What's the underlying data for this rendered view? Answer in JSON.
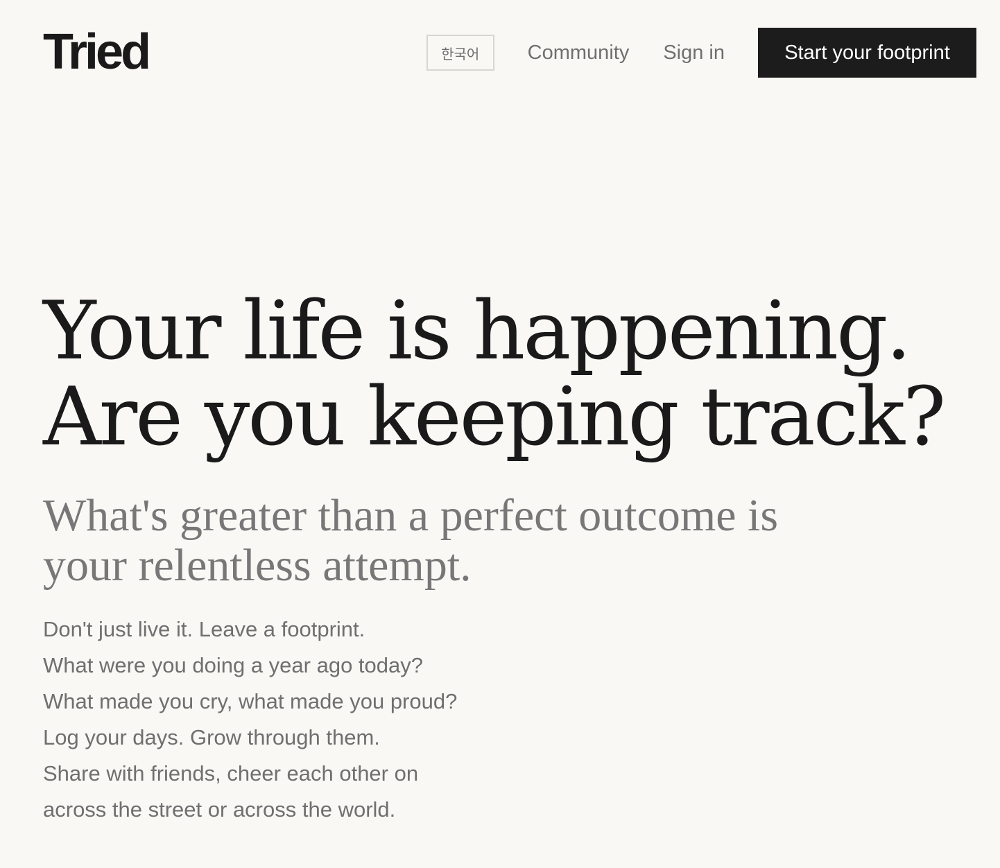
{
  "header": {
    "logo": "Tried",
    "language_button": "한국어",
    "community_link": "Community",
    "signin_link": "Sign in",
    "cta_button": "Start your footprint"
  },
  "hero": {
    "headline_lines": [
      "Your life is happening.",
      "Are you keeping track?"
    ],
    "subheadline": "What's greater than a perfect outcome is your relentless attempt.",
    "body_lines": [
      "Don't just live it. Leave a footprint.",
      "What were you doing a year ago today?",
      "What made you cry, what made you proud?",
      "Log your days. Grow through them.",
      "Share with friends, cheer each other on",
      "across the street or across the world."
    ]
  },
  "colors": {
    "background": "#f9f8f5",
    "text_primary": "#1a1a1a",
    "text_muted": "#6f6f6f",
    "cta_background": "#1c1c1c",
    "cta_text": "#ffffff"
  }
}
